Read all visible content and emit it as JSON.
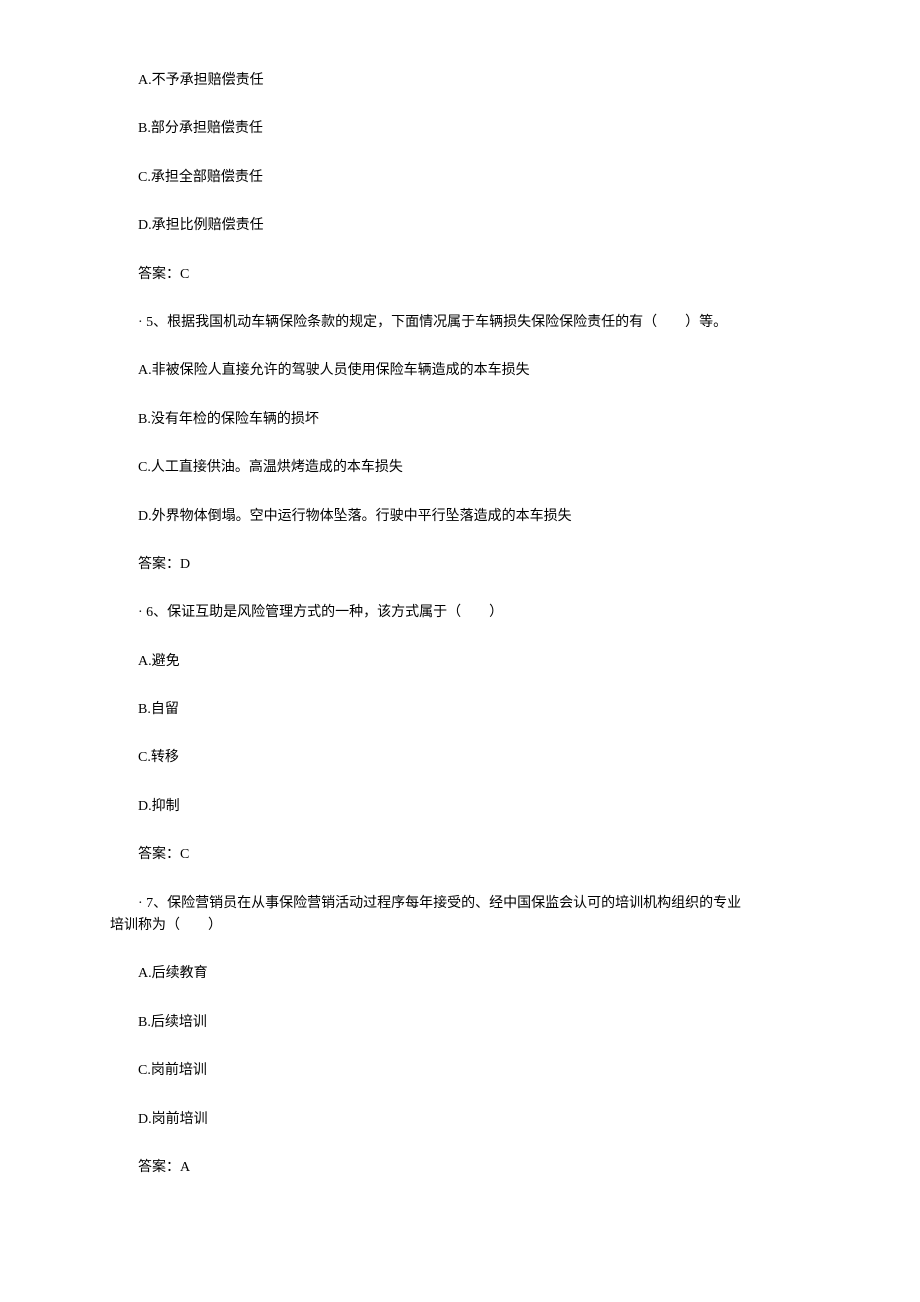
{
  "q4": {
    "optA": "A.不予承担赔偿责任",
    "optB": "B.部分承担赔偿责任",
    "optC": "C.承担全部赔偿责任",
    "optD": "D.承担比例赔偿责任",
    "answer": "答案：C"
  },
  "q5": {
    "stem": "· 5、根据我国机动车辆保险条款的规定，下面情况属于车辆损失保险保险责任的有（　　）等。",
    "optA": "A.非被保险人直接允许的驾驶人员使用保险车辆造成的本车损失",
    "optB": "B.没有年检的保险车辆的损坏",
    "optC": "C.人工直接供油。高温烘烤造成的本车损失",
    "optD": "D.外界物体倒塌。空中运行物体坠落。行驶中平行坠落造成的本车损失",
    "answer": "答案：D"
  },
  "q6": {
    "stem": "· 6、保证互助是风险管理方式的一种，该方式属于（　　）",
    "optA": "A.避免",
    "optB": "B.自留",
    "optC": "C.转移",
    "optD": "D.抑制",
    "answer": "答案：C"
  },
  "q7": {
    "stem_line1": "· 7、保险营销员在从事保险营销活动过程序每年接受的、经中国保监会认可的培训机构组织的专业",
    "stem_line2": "培训称为（　　）",
    "optA": "A.后续教育",
    "optB": "B.后续培训",
    "optC": "C.岗前培训",
    "optD": "D.岗前培训",
    "answer": "答案：A"
  }
}
